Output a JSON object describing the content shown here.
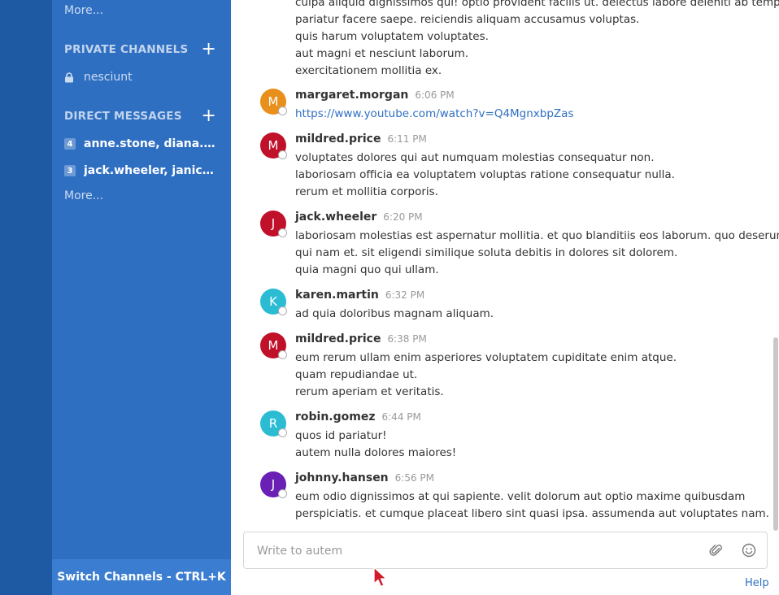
{
  "sidebar": {
    "more_top": "More...",
    "private_channels": {
      "header": "PRIVATE CHANNELS",
      "add_icon": "+",
      "items": [
        {
          "label": "nesciunt",
          "icon": "lock-icon"
        }
      ]
    },
    "direct_messages": {
      "header": "DIRECT MESSAGES",
      "add_icon": "+",
      "items": [
        {
          "count": "4",
          "label": "anne.stone, diana.well..."
        },
        {
          "count": "3",
          "label": "jack.wheeler, janice.ar..."
        }
      ],
      "more": "More..."
    },
    "switch_channels": "Switch Channels - CTRL+K"
  },
  "colors": {
    "team_strip": "#1e5aa3",
    "sidebar": "#2f6fc2",
    "link": "#2f6fc2"
  },
  "posts": [
    {
      "username": "",
      "time": "",
      "lines": [
        "culpa aliquid dignissimos qui! optio provident facilis ut. delectus labore deleniti ab tempore",
        "pariatur facere saepe. reiciendis aliquam accusamus voluptas.",
        "quis harum voluptatem voluptates.",
        "aut magni et nesciunt laborum.",
        "exercitationem mollitia ex."
      ]
    },
    {
      "username": "margaret.morgan",
      "time": "6:06 PM",
      "initial": "M",
      "color": "#e9901c",
      "link": "https://www.youtube.com/watch?v=Q4MgnxbpZas"
    },
    {
      "username": "mildred.price",
      "time": "6:11 PM",
      "initial": "M",
      "color": "#c0102a",
      "lines": [
        "voluptates dolores qui aut numquam molestias consequatur non.",
        "laboriosam officia ea voluptatem voluptas ratione consequatur nulla.",
        "rerum et mollitia corporis."
      ]
    },
    {
      "username": "jack.wheeler",
      "time": "6:20 PM",
      "initial": "J",
      "color": "#c0102a",
      "lines": [
        "laboriosam molestias est aspernatur mollitia. et quo blanditiis eos laborum. quo deserunt",
        "qui nam et. sit eligendi similique soluta debitis in dolores sit dolorem.",
        "quia magni quo qui ullam."
      ]
    },
    {
      "username": "karen.martin",
      "time": "6:32 PM",
      "initial": "K",
      "color": "#2bbcd4",
      "lines": [
        "ad quia doloribus magnam aliquam."
      ]
    },
    {
      "username": "mildred.price",
      "time": "6:38 PM",
      "initial": "M",
      "color": "#c0102a",
      "lines": [
        "eum rerum ullam enim asperiores voluptatem cupiditate enim atque.",
        "quam repudiandae ut.",
        "rerum aperiam et veritatis."
      ]
    },
    {
      "username": "robin.gomez",
      "time": "6:44 PM",
      "initial": "R",
      "color": "#2bbcd4",
      "lines": [
        "quos id pariatur!",
        "autem nulla dolores maiores!"
      ]
    },
    {
      "username": "johnny.hansen",
      "time": "6:56 PM",
      "initial": "J",
      "color": "#6a1fb5",
      "lines": [
        "eum odio dignissimos at qui sapiente. velit dolorum aut optio maxime quibusdam",
        "perspiciatis. et cumque placeat libero sint quasi ipsa. assumenda aut voluptates nam."
      ]
    }
  ],
  "composer": {
    "placeholder": "Write to autem",
    "attach_icon": "paperclip-icon",
    "emoji_icon": "emoji-icon"
  },
  "help": "Help"
}
